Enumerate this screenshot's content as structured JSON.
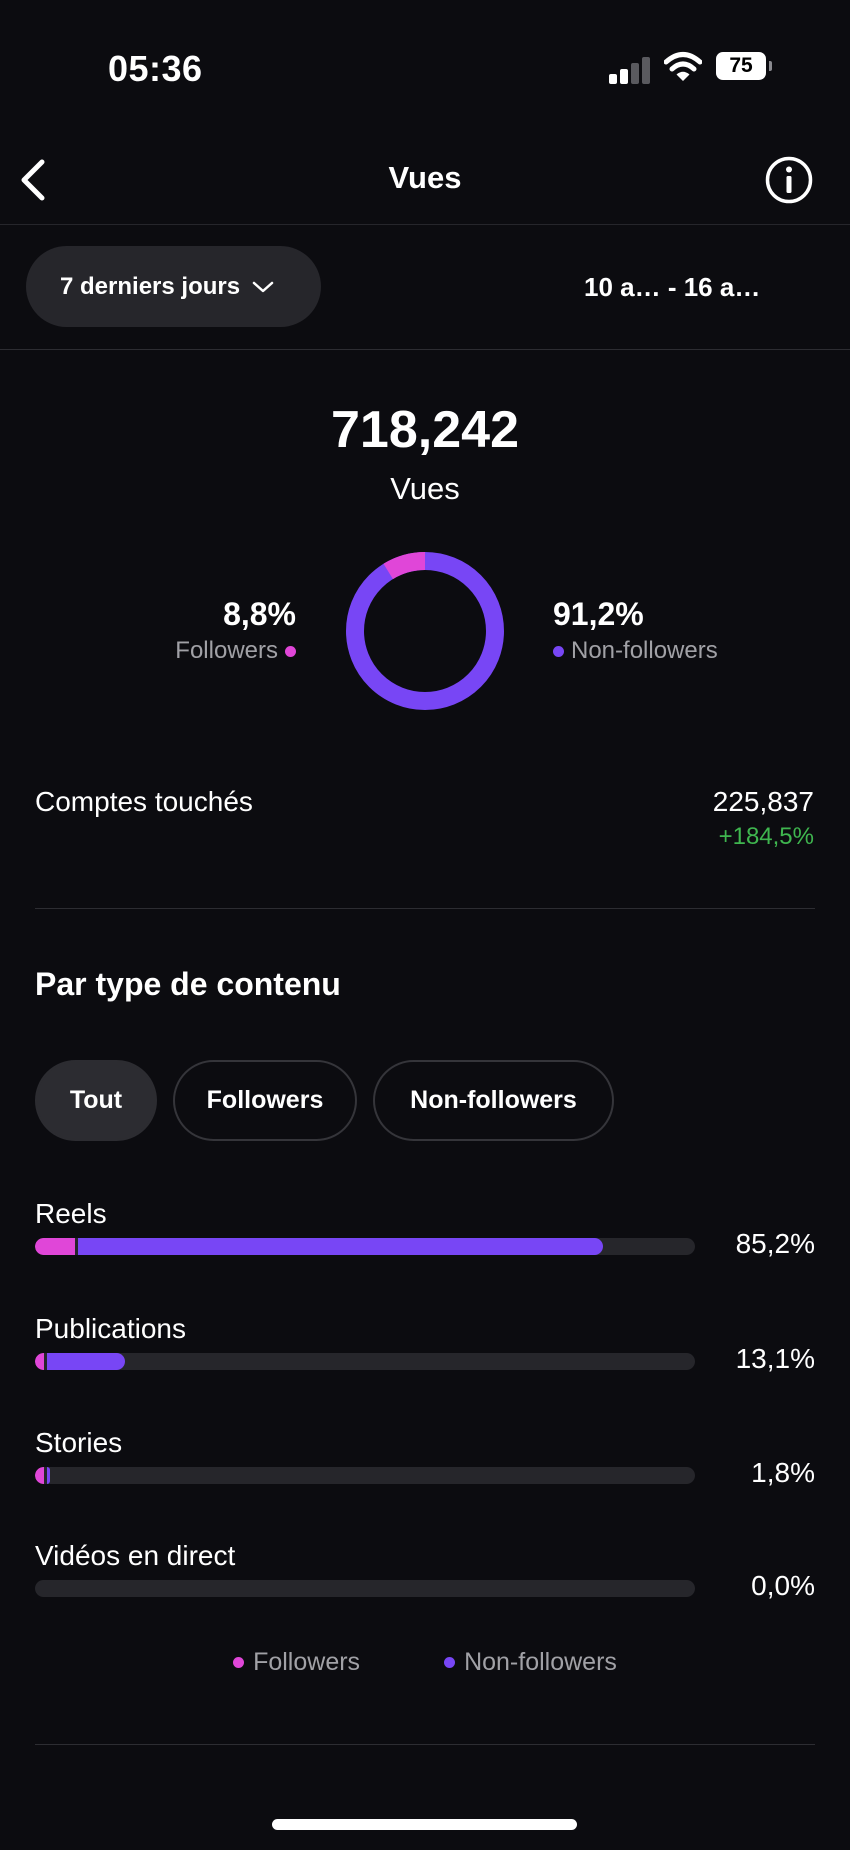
{
  "status_bar": {
    "time": "05:36",
    "battery": "75",
    "icons": [
      "cellular-signal-icon",
      "wifi-icon",
      "battery-icon"
    ]
  },
  "nav": {
    "title": "Vues",
    "back_icon": "chevron-left-icon",
    "info_icon": "info-icon"
  },
  "date_filter": {
    "selected": "7 derniers jours",
    "range": "10 a… - 16 a…"
  },
  "summary": {
    "total": "718,242",
    "label": "Vues",
    "followers_share": "8,8%",
    "followers_label": "Followers",
    "nonfollowers_share": "91,2%",
    "nonfollowers_label": "Non-followers",
    "followers_fraction": 0.088
  },
  "reach": {
    "label": "Comptes touchés",
    "value": "225,837",
    "change": "+184,5%"
  },
  "content_type": {
    "title": "Par type de contenu",
    "tabs": [
      "Tout",
      "Followers",
      "Non-followers"
    ],
    "active_tab": "Tout",
    "rows": [
      {
        "label": "Reels",
        "percent": "85,2%",
        "followers_fraction": 0.06,
        "nonfollowers_fraction": 0.795
      },
      {
        "label": "Publications",
        "percent": "13,1%",
        "followers_fraction": 0.013,
        "nonfollowers_fraction": 0.118
      },
      {
        "label": "Stories",
        "percent": "1,8%",
        "followers_fraction": 0.013,
        "nonfollowers_fraction": 0.005
      },
      {
        "label": "Vidéos en direct",
        "percent": "0,0%",
        "followers_fraction": 0.0,
        "nonfollowers_fraction": 0.0
      }
    ],
    "legend": [
      "Followers",
      "Non-followers"
    ]
  },
  "colors": {
    "background": "#0c0c10",
    "followers": "#e046d8",
    "nonfollowers": "#7846f5",
    "positive": "#3fb64f",
    "track": "#26262b"
  }
}
